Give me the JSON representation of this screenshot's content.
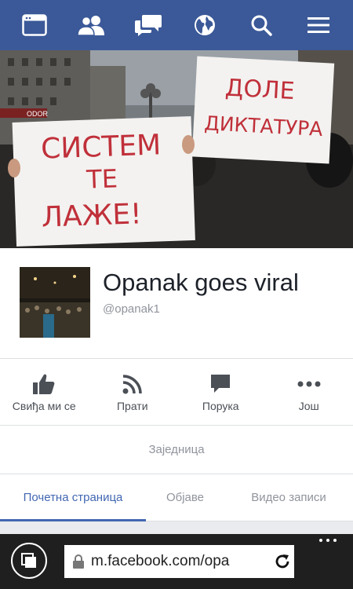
{
  "topbar": {
    "icons": [
      "news-feed-icon",
      "friends-icon",
      "messages-icon",
      "notifications-globe-icon",
      "search-icon",
      "menu-icon"
    ],
    "bg_color": "#3b5998"
  },
  "cover": {
    "sign_left": {
      "lines": [
        "СИСТЕМ",
        "ТЕ",
        "ЛАЖЕ!"
      ]
    },
    "sign_right": {
      "lines": [
        "ДОЛЕ",
        "ДИКТАТУРА"
      ]
    },
    "storefront_text": "ODOR"
  },
  "profile": {
    "name": "Opanak goes viral",
    "handle": "@opanak1"
  },
  "actions": {
    "like_label": "Свиђа ми се",
    "follow_label": "Прати",
    "message_label": "Порука",
    "more_label": "Још"
  },
  "community_label": "Заједница",
  "tabs": {
    "items": [
      "Почетна страница",
      "Објаве",
      "Видео записи"
    ],
    "active": "Почетна страница"
  },
  "browser": {
    "url": "m.facebook.com/opa"
  },
  "colors": {
    "brand": "#3b5998",
    "accent": "#4267b2",
    "sign_ink": "#c0303a"
  }
}
